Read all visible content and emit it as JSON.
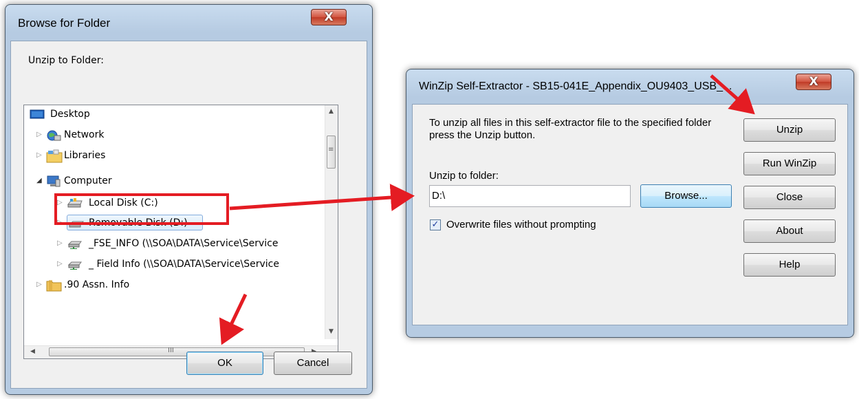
{
  "browse_dialog": {
    "title": "Browse for Folder",
    "close_glyph": "X",
    "prompt": "Unzip to Folder:",
    "tree": [
      {
        "label": "Desktop",
        "icon": "desktop-icon"
      },
      {
        "label": "Network",
        "icon": "network-icon"
      },
      {
        "label": "Libraries",
        "icon": "libraries-icon"
      },
      {
        "label": "Computer",
        "icon": "computer-icon"
      },
      {
        "label": "Local Disk (C:)",
        "icon": "local-disk-icon"
      },
      {
        "label": "Removable Disk (D:)",
        "icon": "removable-disk-icon"
      },
      {
        "label": "_FSE_INFO (\\\\SOA\\DATA\\Service\\Service",
        "icon": "network-drive-icon"
      },
      {
        "label": "_ Field Info (\\\\SOA\\DATA\\Service\\Service",
        "icon": "network-drive-icon"
      },
      {
        "label": ".90 Assn. Info",
        "icon": "folder-icon"
      }
    ],
    "ok_label": "OK",
    "cancel_label": "Cancel",
    "hscroll_grip": "III",
    "vscroll_grip": "≡"
  },
  "winzip_dialog": {
    "title": "WinZip Self-Extractor - SB15-041E_Appendix_OU9403_USB_...",
    "close_glyph": "X",
    "instructions": "To unzip all files in this self-extractor file to the specified folder press the Unzip button.",
    "folder_label": "Unzip to folder:",
    "folder_value": "D:\\",
    "browse_label": "Browse...",
    "overwrite_label": "Overwrite files without prompting",
    "overwrite_checked": true,
    "buttons": [
      "Unzip",
      "Run WinZip",
      "Close",
      "About",
      "Help"
    ]
  },
  "annotation_color": "#e41c23"
}
